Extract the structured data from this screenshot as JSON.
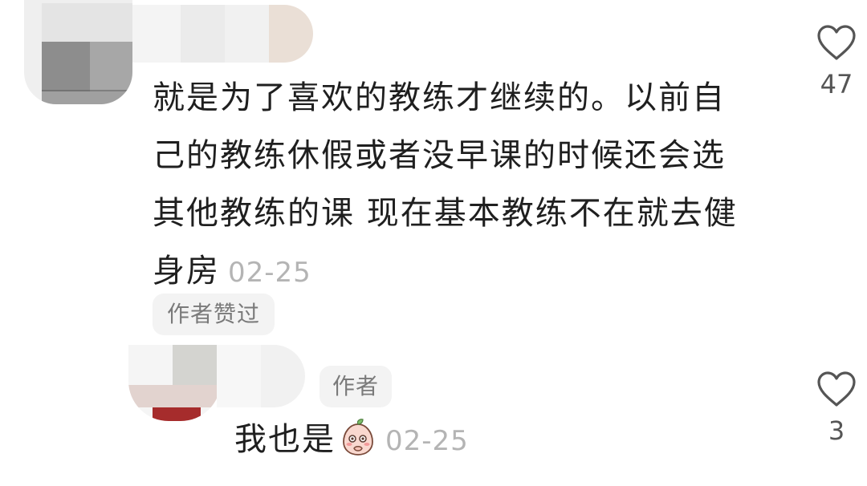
{
  "comment": {
    "text_lines": [
      "就是为了喜欢的教练才继续的。以前自",
      "己的教练休假或者没早课的时候还会选",
      "其他教练的课 现在基本教练不在就去健",
      "身房"
    ],
    "time": "02-25",
    "author_liked_label": "作者赞过",
    "likes": "47"
  },
  "reply": {
    "author_tag": "作者",
    "text": "我也是",
    "emoji": "shy-peach-emoji",
    "time": "02-25",
    "likes": "3"
  },
  "icons": {
    "like": "heart-outline-icon"
  },
  "colors": {
    "text": "#1f1f1f",
    "timestamp": "#b4b4b4",
    "tag_bg": "#f3f3f3",
    "tag_text": "#7a7a7a",
    "icon": "#555555"
  }
}
